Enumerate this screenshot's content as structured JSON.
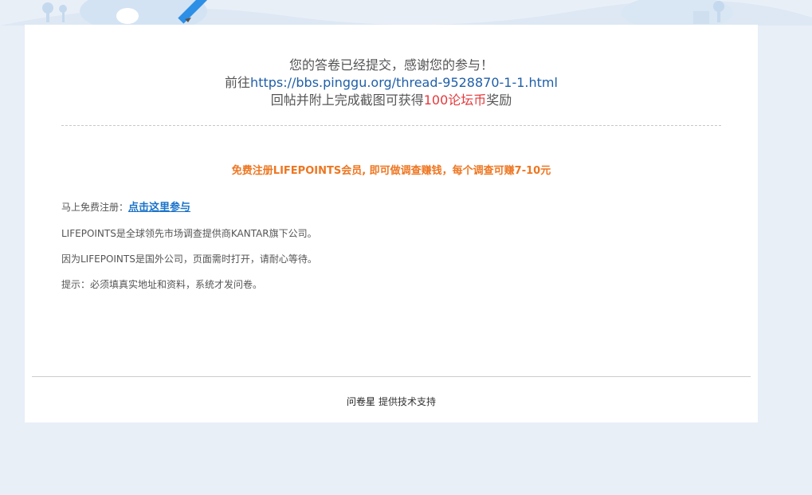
{
  "thanks": {
    "line1": "您的答卷已经提交，感谢您的参与！",
    "line2_prefix": "前往",
    "line2_link": "https://bbs.pinggu.org/thread-9528870-1-1.html",
    "line3_prefix": "回帖并附上完成截图可获得",
    "line3_highlight": "100论坛币",
    "line3_suffix": "奖励"
  },
  "promo": {
    "headline": "免费注册LIFEPOINTS会员, 即可做调查赚钱，每个调查可赚7-10元"
  },
  "info": {
    "register_prefix": "马上免费注册：",
    "register_link": "点击这里参与",
    "line2": "LIFEPOINTS是全球领先市场调查提供商KANTAR旗下公司。",
    "line3": "因为LIFEPOINTS是国外公司，页面需时打开，请耐心等待。",
    "line4": "提示：必须填真实地址和资料，系统才发问卷。"
  },
  "footer": {
    "brand": "问卷星",
    "text": "提供技术支持"
  },
  "colors": {
    "background": "#e9eff7",
    "link_blue": "#1f5fa8",
    "highlight_red": "#e4393c",
    "promo_orange": "#ee7621"
  }
}
